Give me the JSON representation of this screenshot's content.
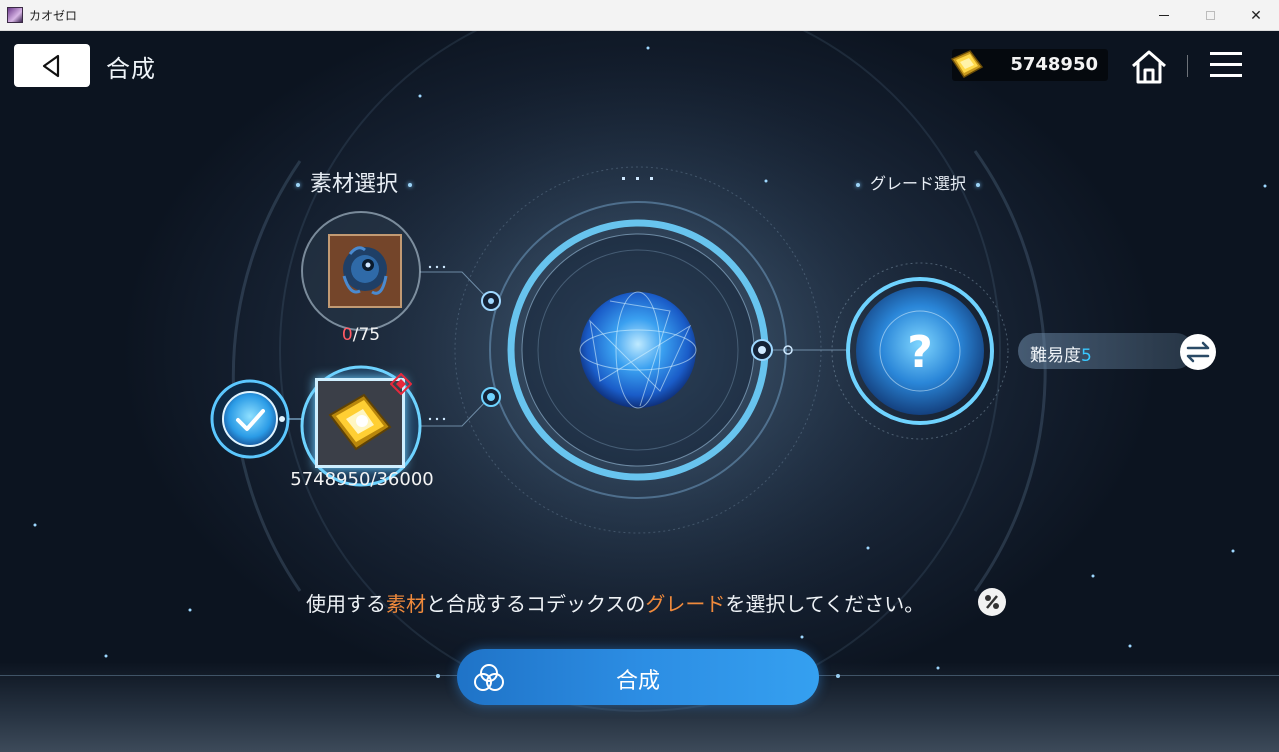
{
  "window": {
    "title": "カオゼロ",
    "minimize_label": "",
    "close_label": "✕"
  },
  "header": {
    "title": "合成",
    "currency_value": "5748950"
  },
  "material_section": {
    "label": "素材選択",
    "slots": [
      {
        "name": "blue-creature-material",
        "count_current": "0",
        "count_rest": "/75"
      },
      {
        "name": "gold-crystal-material",
        "count": "5748950/36000",
        "selected": true
      }
    ]
  },
  "grade_section": {
    "label": "グレード選択",
    "unknown_glyph": "?",
    "difficulty_label": "難易度",
    "difficulty_value": "5"
  },
  "instruction": {
    "part1": "使用する",
    "highlight1": "素材",
    "part2": "と合成するコデックスの",
    "highlight2": "グレード",
    "part3": "を選択してください。"
  },
  "synth_button": {
    "label": "合成"
  },
  "colors": {
    "accent_blue": "#2c8de3",
    "highlight_orange": "#f08a3c",
    "count_red": "#ff5a64",
    "difficulty_cyan": "#3ac8ff"
  },
  "icons": [
    "back-arrow-icon",
    "gold-crystal-icon",
    "home-icon",
    "menu-icon",
    "check-icon",
    "question-icon",
    "swap-icon",
    "percent-icon",
    "synthesis-icon"
  ]
}
